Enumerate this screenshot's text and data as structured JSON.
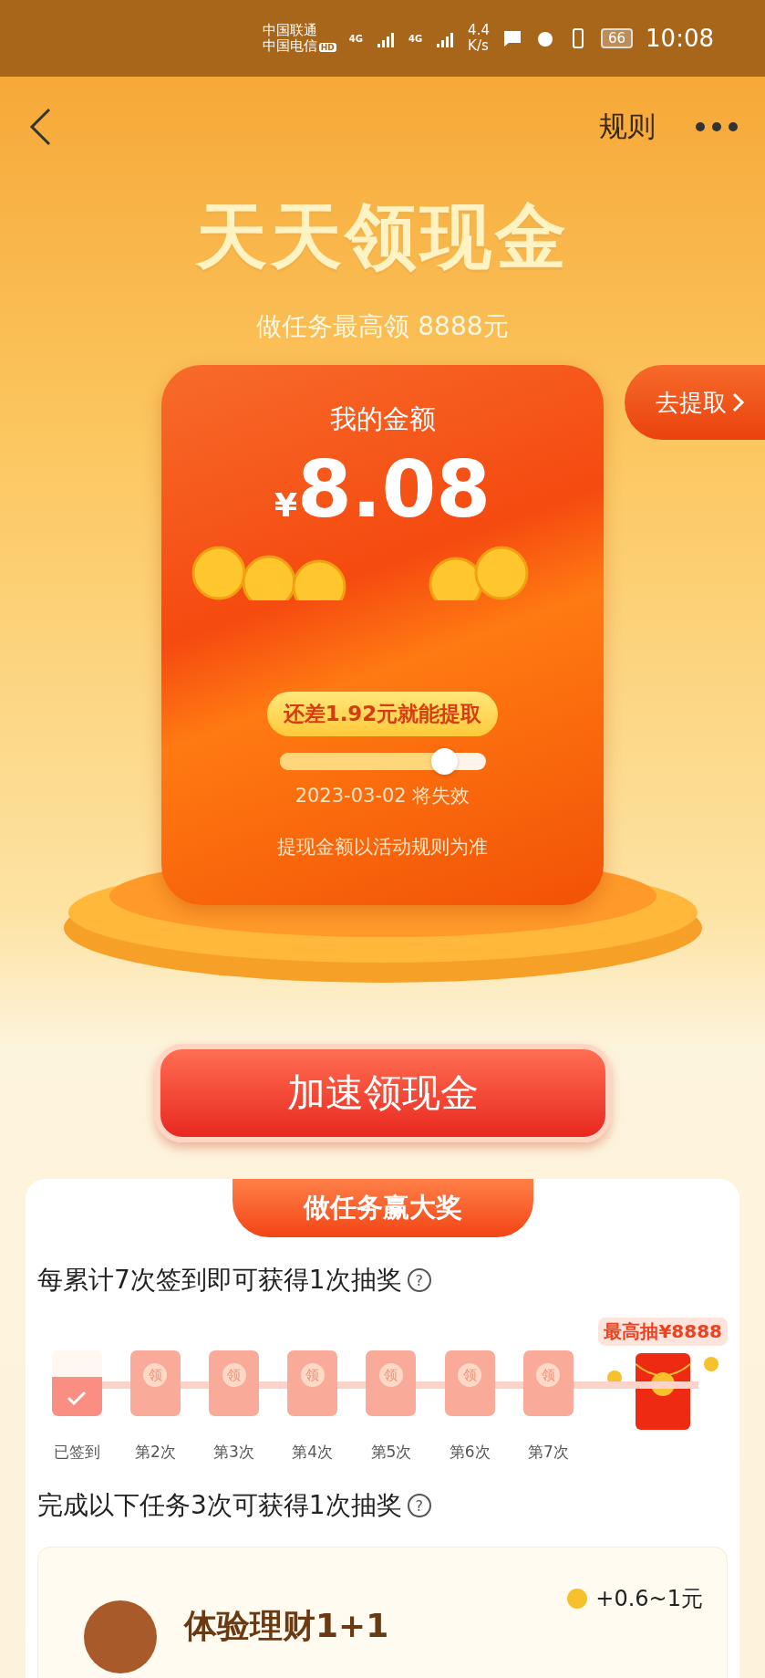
{
  "status_bar": {
    "carriers": [
      "中国联通",
      "中国电信"
    ],
    "hd_badge": "HD",
    "networks": [
      "4G",
      "4G"
    ],
    "speed_value": "4.4",
    "speed_unit": "K/s",
    "battery": "66",
    "time": "10:08"
  },
  "nav": {
    "rules": "规则"
  },
  "hero": {
    "title": "天天领现金",
    "subtitle": "做任务最高领 8888元"
  },
  "withdraw_tab": "去提取",
  "balance": {
    "label": "我的金额",
    "currency": "¥",
    "amount": "8.08",
    "tip": "还差1.92元就能提取",
    "level": 0.8,
    "expiry": "2023-03-02 将失效",
    "note": "提现金额以活动规则为准"
  },
  "boost_button": "加速领现金",
  "tasks": {
    "header": "做任务赢大奖",
    "signin": {
      "title": "每累计7次签到即可获得1次抽奖",
      "help": "?",
      "prize_badge": "最高抽¥8888",
      "days": [
        {
          "label": "已签到",
          "checked": true
        },
        {
          "label": "第2次",
          "checked": false,
          "glyph": "领"
        },
        {
          "label": "第3次",
          "checked": false,
          "glyph": "领"
        },
        {
          "label": "第4次",
          "checked": false,
          "glyph": "领"
        },
        {
          "label": "第5次",
          "checked": false,
          "glyph": "领"
        },
        {
          "label": "第6次",
          "checked": false,
          "glyph": "领"
        },
        {
          "label": "第7次",
          "checked": false,
          "glyph": "领"
        }
      ]
    },
    "task_section": {
      "title": "完成以下任务3次可获得1次抽奖",
      "help": "?",
      "items": [
        {
          "name": "体验理财1+1",
          "reward": "+0.6~1元"
        }
      ]
    }
  }
}
